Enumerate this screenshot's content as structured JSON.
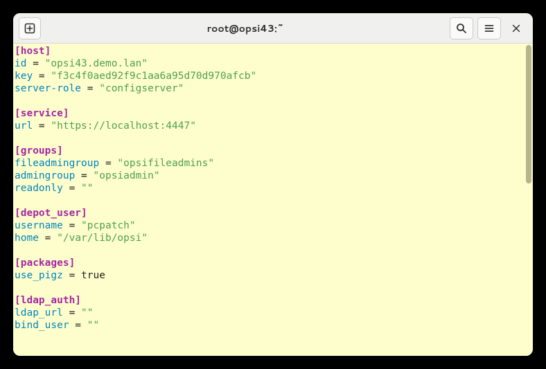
{
  "window": {
    "title": "root@opsi43:~"
  },
  "config": {
    "host": {
      "section": "[host]",
      "id_key": "id",
      "id_val": "\"opsi43.demo.lan\"",
      "key_key": "key",
      "key_val": "\"f3c4f0aed92f9c1aa6a95d70d970afcb\"",
      "role_key": "server-role",
      "role_val": "\"configserver\""
    },
    "service": {
      "section": "[service]",
      "url_key": "url",
      "url_val": "\"https://localhost:4447\""
    },
    "groups": {
      "section": "[groups]",
      "fa_key": "fileadmingroup",
      "fa_val": "\"opsifileadmins\"",
      "ag_key": "admingroup",
      "ag_val": "\"opsiadmin\"",
      "ro_key": "readonly",
      "ro_val": "\"\""
    },
    "depot_user": {
      "section": "[depot_user]",
      "un_key": "username",
      "un_val": "\"pcpatch\"",
      "home_key": "home",
      "home_val": "\"/var/lib/opsi\""
    },
    "packages": {
      "section": "[packages]",
      "pigz_key": "use_pigz",
      "pigz_val": "true"
    },
    "ldap_auth": {
      "section": "[ldap_auth]",
      "url_key": "ldap_url",
      "url_val": "\"\"",
      "bind_key": "bind_user",
      "bind_val": "\"\""
    }
  },
  "eq": " = "
}
